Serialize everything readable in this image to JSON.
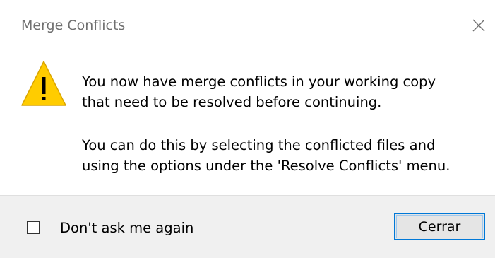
{
  "dialog": {
    "title": "Merge Conflicts",
    "close_icon": "close-icon",
    "warning_icon": "warning-icon",
    "message_line1": "You now have merge conflicts in your working copy",
    "message_line2": "that need to be resolved before continuing.",
    "message_line3": "You can do this by selecting the conflicted files and",
    "message_line4": "using the options under the 'Resolve Conflicts' menu.",
    "checkbox_label": "Don't ask me again",
    "checkbox_checked": false,
    "close_button_label": "Cerrar",
    "accent_color": "#0078d7",
    "warning_color": "#ffcc00"
  }
}
